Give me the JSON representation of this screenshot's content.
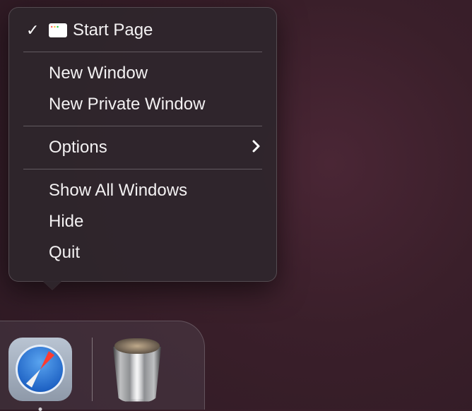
{
  "menu": {
    "current_window": {
      "label": "Start Page",
      "checked": true
    },
    "items_a": [
      {
        "label": "New Window"
      },
      {
        "label": "New Private Window"
      }
    ],
    "options": {
      "label": "Options",
      "has_submenu": true
    },
    "items_b": [
      {
        "label": "Show All Windows"
      },
      {
        "label": "Hide"
      },
      {
        "label": "Quit"
      }
    ]
  },
  "dock": {
    "app": {
      "name": "Safari",
      "running": true
    },
    "trash": {
      "name": "Trash",
      "full": true
    }
  }
}
